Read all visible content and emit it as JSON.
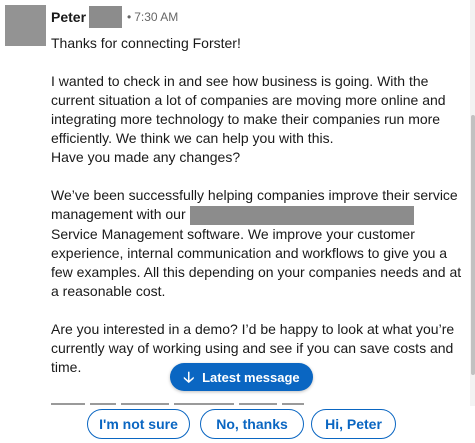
{
  "message": {
    "sender": "Peter",
    "separator": "•",
    "time": "7:30 AM",
    "paragraphs": {
      "p1": "Thanks for connecting Forster!",
      "p2": "I wanted to check in and see how business is going. With the current situation a lot of companies are moving more online and integrating more technology to make their companies run more efficiently. We think we can help you with this.",
      "p2b": "Have you made any changes?",
      "p3a": "We’ve been successfully helping companies improve their service management with our",
      "p3b": "Service Management software. We improve your customer experience, internal communication and workflows to give you a few examples. All this depending on your companies needs and at a reasonable cost.",
      "p4": "Are you interested in a demo? I’d be happy to look at what you’re currently way of working using and see if you can save costs and time."
    }
  },
  "latest_button": {
    "label": "Latest message",
    "icon": "arrow-down-icon"
  },
  "suggested_replies": [
    "I'm not sure",
    "No, thanks",
    "Hi, Peter"
  ],
  "colors": {
    "accent": "#0a66c2",
    "redaction": "#8c8c8c",
    "text": "#191919",
    "muted": "#666666"
  }
}
